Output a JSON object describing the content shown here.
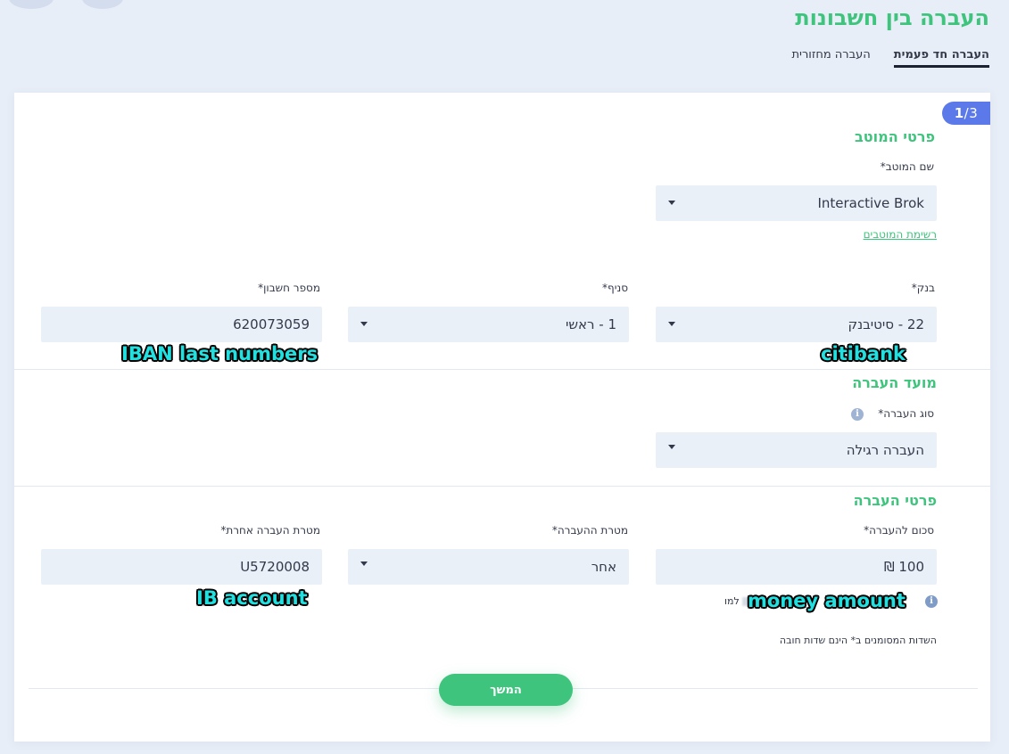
{
  "page": {
    "title": "העברה בין חשבונות",
    "tabs": [
      {
        "label": "העברה חד פעמית",
        "active": true
      },
      {
        "label": "העברה מחזורית",
        "active": false
      }
    ]
  },
  "step": {
    "current": "1",
    "total": "/3"
  },
  "beneficiary": {
    "section_title": "פרטי המוטב",
    "name_label": "שם המוטב*",
    "name_value": "Interactive Brok",
    "list_link": "רשימת המוטבים",
    "bank_label": "בנק*",
    "bank_value": "22 - סיטיבנק",
    "branch_label": "סניף*",
    "branch_value": "1 - ראשי",
    "account_label": "מספר חשבון*",
    "account_value": "620073059"
  },
  "schedule": {
    "section_title": "מועד העברה",
    "type_label": "סוג העברה*",
    "type_value": "העברה רגילה"
  },
  "transfer": {
    "section_title": "פרטי העברה",
    "amount_label": "סכום להעברה*",
    "amount_value": "100 ₪",
    "purpose_label": "מטרת ההעברה*",
    "purpose_value": "אחר",
    "other_purpose_label": "מטרת העברה אחרת*",
    "other_purpose_value": "U5720008",
    "amount_hint_prefix": "למו",
    "amount_hint_currency": "₪"
  },
  "footnote": "השדות המסומנים ב* הינם שדות חובה",
  "continue_label": "המשך",
  "annotations": {
    "iban": "IBAN last numbers",
    "bank": "citibank",
    "account": "IB account",
    "amount": "money amount"
  },
  "colors": {
    "accent_green": "#3ec47c",
    "badge_blue": "#5b79e8",
    "field_bg": "#eaf0f8",
    "page_bg": "#e8eef7",
    "annotation_cyan": "#23e0e0"
  },
  "icons": [
    "chevron-down-icon",
    "info-icon"
  ]
}
